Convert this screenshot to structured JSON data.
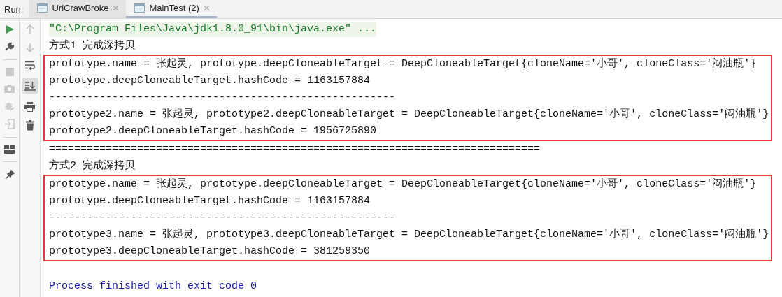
{
  "run_label": "Run:",
  "tabs": [
    {
      "label": "UrlCrawBroke",
      "selected": false
    },
    {
      "label": "MainTest (2)",
      "selected": true
    }
  ],
  "scroll_to_end": {
    "on": true
  },
  "console": [
    {
      "kind": "command",
      "text": "\"C:\\Program Files\\Java\\jdk1.8.0_91\\bin\\java.exe\" ..."
    },
    {
      "kind": "text",
      "text": "方式1 完成深拷贝"
    },
    {
      "kind": "box",
      "lines": [
        "prototype.name = 张起灵, prototype.deepCloneableTarget = DeepCloneableTarget{cloneName='小哥', cloneClass='闷油瓶'}",
        "prototype.deepCloneableTarget.hashCode = 1163157884",
        "-------------------------------------------------------",
        "prototype2.name = 张起灵, prototype2.deepCloneableTarget = DeepCloneableTarget{cloneName='小哥', cloneClass='闷油瓶'}",
        "prototype2.deepCloneableTarget.hashCode = 1956725890"
      ]
    },
    {
      "kind": "text",
      "text": "=============================================================================="
    },
    {
      "kind": "text",
      "text": "方式2 完成深拷贝"
    },
    {
      "kind": "box",
      "lines": [
        "prototype.name = 张起灵, prototype.deepCloneableTarget = DeepCloneableTarget{cloneName='小哥', cloneClass='闷油瓶'}",
        "prototype.deepCloneableTarget.hashCode = 1163157884",
        "-------------------------------------------------------",
        "prototype3.name = 张起灵, prototype3.deepCloneableTarget = DeepCloneableTarget{cloneName='小哥', cloneClass='闷油瓶'}",
        "prototype3.deepCloneableTarget.hashCode = 381259350"
      ]
    },
    {
      "kind": "exit",
      "text": "Process finished with exit code 0"
    }
  ]
}
